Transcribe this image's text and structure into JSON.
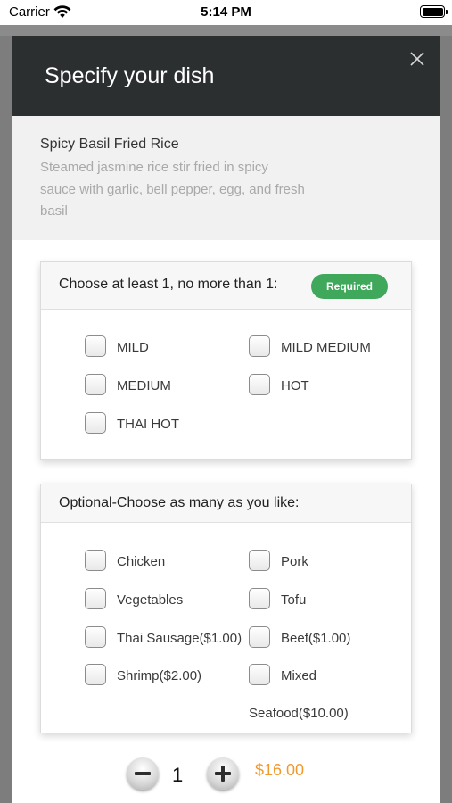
{
  "status_bar": {
    "carrier": "Carrier",
    "time": "5:14 PM"
  },
  "modal": {
    "title": "Specify your dish",
    "close_icon": "close-icon"
  },
  "dish": {
    "name": "Spicy Basil Fried Rice",
    "description": "Steamed jasmine rice stir fried in spicy sauce with garlic, bell pepper, egg, and fresh basil"
  },
  "spice_group": {
    "title": "Choose at least 1, no more than 1:",
    "badge": "Required",
    "badge_color": "#3fa85b",
    "options": [
      {
        "label": "MILD",
        "checked": false
      },
      {
        "label": "MILD MEDIUM",
        "checked": false
      },
      {
        "label": "MEDIUM",
        "checked": false
      },
      {
        "label": "HOT",
        "checked": false
      },
      {
        "label": "THAI HOT",
        "checked": false
      }
    ]
  },
  "addon_group": {
    "title": "Optional-Choose as many as you like:",
    "options": [
      {
        "label": "Chicken",
        "checked": false
      },
      {
        "label": "Pork",
        "checked": false
      },
      {
        "label": "Vegetables",
        "checked": false
      },
      {
        "label": "Tofu",
        "checked": false
      },
      {
        "label": "Thai Sausage($1.00)",
        "checked": false
      },
      {
        "label": "Beef($1.00)",
        "checked": false
      },
      {
        "label": "Shrimp($2.00)",
        "checked": false
      },
      {
        "label": "Mixed",
        "label_line2": "Seafood($10.00)",
        "checked": false
      }
    ]
  },
  "order": {
    "quantity": "1",
    "price": "$16.00",
    "price_color": "#f09a2e",
    "decrement_icon": "minus-icon",
    "increment_icon": "plus-icon"
  }
}
